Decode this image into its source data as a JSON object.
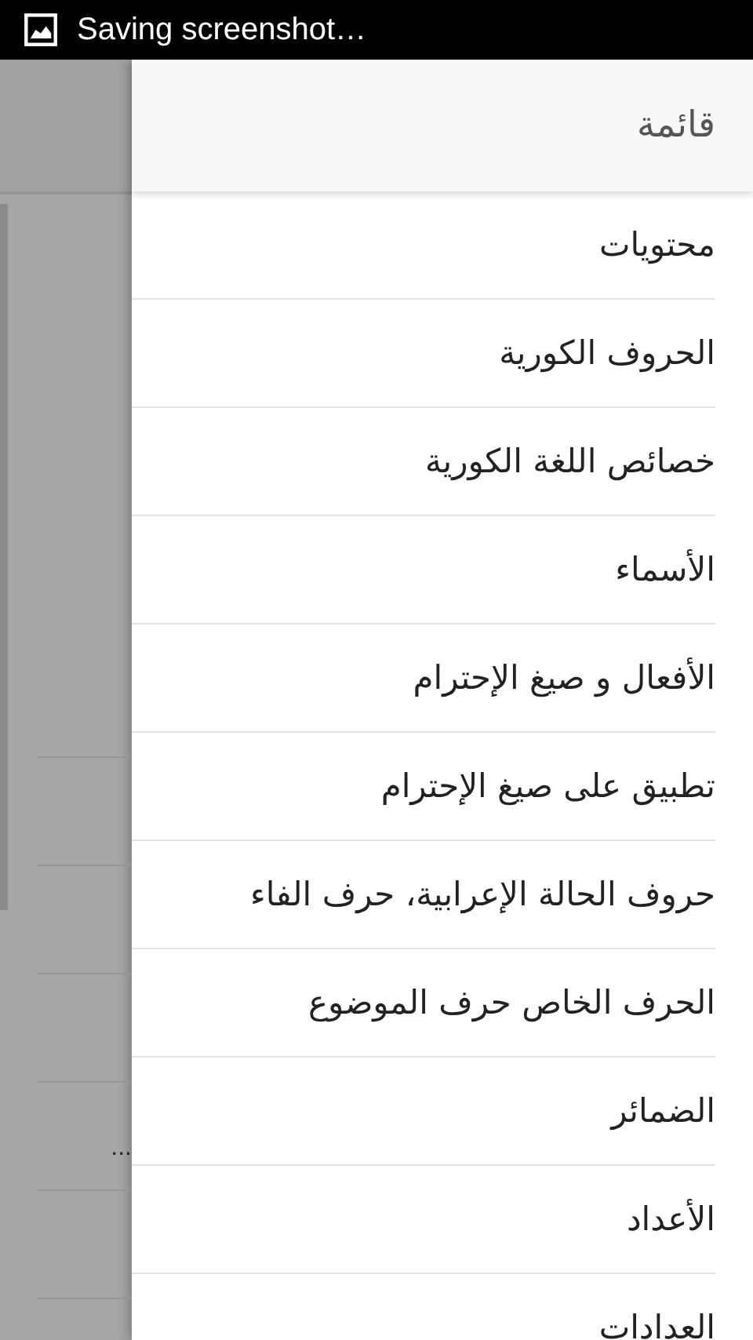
{
  "status_bar": {
    "notification": "Saving screenshot…"
  },
  "background": {
    "truncated_text": "..."
  },
  "drawer": {
    "title": "قائمة",
    "items": [
      {
        "label": "محتويات"
      },
      {
        "label": "الحروف الكورية"
      },
      {
        "label": "خصائص اللغة الكورية"
      },
      {
        "label": "الأسماء"
      },
      {
        "label": "الأفعال و صيغ الإحترام"
      },
      {
        "label": "تطبيق على صيغ الإحترام"
      },
      {
        "label": "حروف الحالة الإعرابية، حرف الفاء"
      },
      {
        "label": "الحرف الخاص حرف الموضوع"
      },
      {
        "label": "الضمائر"
      },
      {
        "label": "الأعداد"
      },
      {
        "label": "العدادات"
      }
    ]
  }
}
